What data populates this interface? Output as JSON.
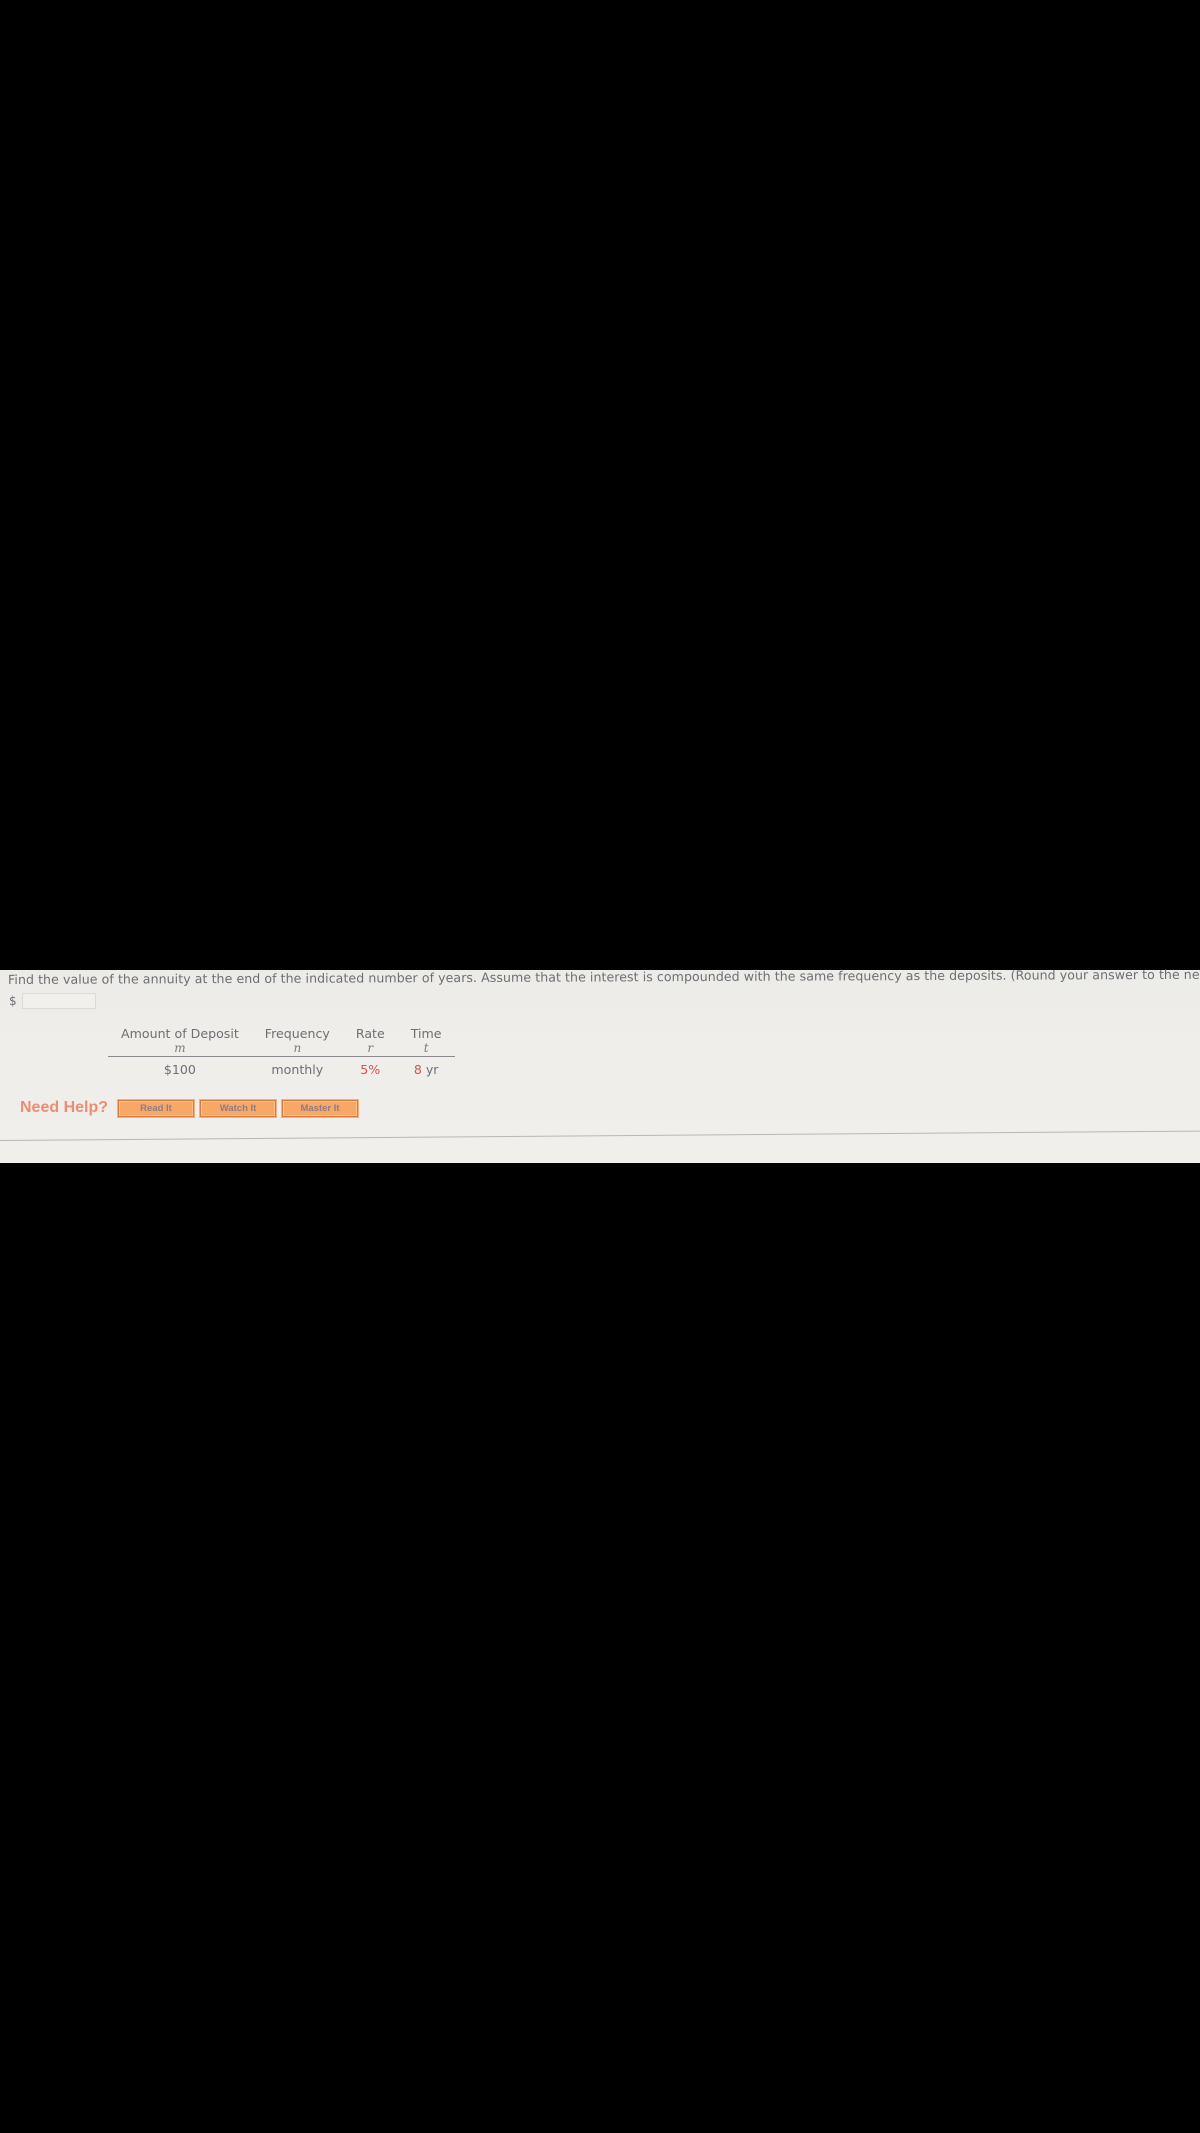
{
  "question": {
    "text": "Find the value of the annuity at the end of the indicated number of years. Assume that the interest is compounded with the same frequency as the deposits. (Round your answer to the nearest cent.)"
  },
  "answer": {
    "currency_symbol": "$",
    "value": "",
    "placeholder": ""
  },
  "table": {
    "headers": [
      {
        "label": "Amount of Deposit",
        "variable": "m"
      },
      {
        "label": "Frequency",
        "variable": "n"
      },
      {
        "label": "Rate",
        "variable": "r"
      },
      {
        "label": "Time",
        "variable": "t"
      }
    ],
    "row": {
      "amount": "$100",
      "frequency": "monthly",
      "rate": "5%",
      "time_value": "8",
      "time_unit": "yr"
    },
    "highlight_color": "#d9534f"
  },
  "help": {
    "label": "Need Help?",
    "buttons": [
      {
        "label": "Read It"
      },
      {
        "label": "Watch It"
      },
      {
        "label": "Master It"
      }
    ],
    "accent_color": "#f7a866"
  }
}
